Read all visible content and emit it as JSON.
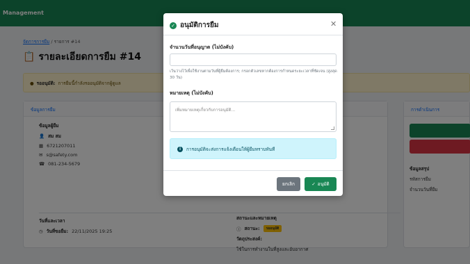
{
  "app": {
    "brand": "Management"
  },
  "breadcrumb": {
    "link": "จัดการการยืม",
    "separator": "/",
    "current": "รายการ #14"
  },
  "page_title": "รายละเอียดการยืม #14",
  "alert": {
    "label": "รออนุมัติ:",
    "text": "การยืมนี้กำลังรออนุมัติจากผู้ดูแล"
  },
  "main_card": {
    "header": "ข้อมูลการยืม",
    "borrower": {
      "heading": "ข้อมูลผู้ยืม",
      "name": "สม สม",
      "id": "6721207011",
      "email": "s@safety.com",
      "phone": "081-234-5679"
    },
    "datetime": {
      "heading": "วันที่และเวลา",
      "requested_label": "วันที่ขอยืม:",
      "requested_value": "22/11/2025 19:25"
    },
    "col2": {
      "heading": "สถานะและหมายเหตุ",
      "status_label": "สถานะ:",
      "status_value": "รออนุมัติ",
      "purpose_label": "วัตถุประสงค์:",
      "purpose_value": "ใช้ในการทำงานในที่สูงและอับอากาศ"
    }
  },
  "side_card": {
    "header": "การดำเนินการ",
    "summary_heading": "ข้อมูลสรุป",
    "summary_items": [
      "รหัสการยืม",
      "จำนวนวันที่ยืม"
    ]
  },
  "modal": {
    "title": "อนุมัติการยืม",
    "days_label": "จำนวนวันที่อนุญาต (ไม่บังคับ)",
    "days_value": "",
    "days_help": "เว้นว่างไว้เพื่อใช้งานตามวันที่ผู้ยืมต้องการ; กรอกตัวเลขหากต้องการกำหนดระยะเวลาที่ชัดเจน (สูงสุด 30 วัน)",
    "note_label": "หมายเหตุ (ไม่บังคับ)",
    "note_placeholder": "เพิ่มหมายเหตุเกี่ยวกับการอนุมัติ...",
    "info_text": "การอนุมัติจะส่งการแจ้งเตือนให้ผู้ยืมทราบทันที",
    "cancel_label": "ยกเลิก",
    "approve_label": "อนุมัติ"
  },
  "colors": {
    "primary_green": "#198754",
    "danger_red": "#dc3545",
    "info_bg": "#cff4fc",
    "warning_bg": "#fff3cd"
  }
}
